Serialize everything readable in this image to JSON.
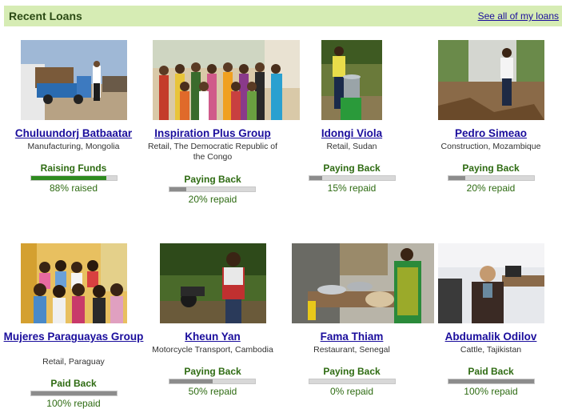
{
  "header": {
    "title": "Recent Loans",
    "see_all": "See all of my loans"
  },
  "colors": {
    "header_bg": "#d6ecb4",
    "link": "#1a0d9c",
    "status_text": "#2e6b12",
    "progress_raising": "#2e8b1f",
    "progress_paying": "#8c8c8c",
    "progress_track": "#d8d8d8"
  },
  "loans": [
    {
      "name": "Chuluundorj Batbaatar",
      "meta": "Manufacturing, Mongolia",
      "status": "Raising Funds",
      "progress": 0.88,
      "progress_text": "88% raised",
      "photo_icon": "truck-photo"
    },
    {
      "name": "Inspiration Plus Group",
      "meta": "Retail, The Democratic Republic of the Congo",
      "status": "Paying Back",
      "progress": 0.2,
      "progress_text": "20% repaid",
      "photo_icon": "group-photo"
    },
    {
      "name": "Idongi Viola",
      "meta": "Retail, Sudan",
      "status": "Paying Back",
      "progress": 0.15,
      "progress_text": "15% repaid",
      "photo_icon": "person-bucket-photo"
    },
    {
      "name": "Pedro Simeao",
      "meta": "Construction, Mozambique",
      "status": "Paying Back",
      "progress": 0.2,
      "progress_text": "20% repaid",
      "photo_icon": "person-wall-photo"
    },
    {
      "name": "Mujeres Paraguayas Group",
      "meta": "Retail, Paraguay",
      "status": "Paid Back",
      "progress": 1.0,
      "progress_text": "100% repaid",
      "photo_icon": "group-women-photo"
    },
    {
      "name": "Kheun Yan",
      "meta": "Motorcycle Transport, Cambodia",
      "status": "Paying Back",
      "progress": 0.5,
      "progress_text": "50% repaid",
      "photo_icon": "person-motorcycle-photo"
    },
    {
      "name": "Fama Thiam",
      "meta": "Restaurant, Senegal",
      "status": "Paying Back",
      "progress": 0.0,
      "progress_text": "0% repaid",
      "photo_icon": "kitchen-photo"
    },
    {
      "name": "Abdumalik Odilov",
      "meta": "Cattle, Tajikistan",
      "status": "Paid Back",
      "progress": 1.0,
      "progress_text": "100% repaid",
      "photo_icon": "office-person-photo"
    }
  ]
}
